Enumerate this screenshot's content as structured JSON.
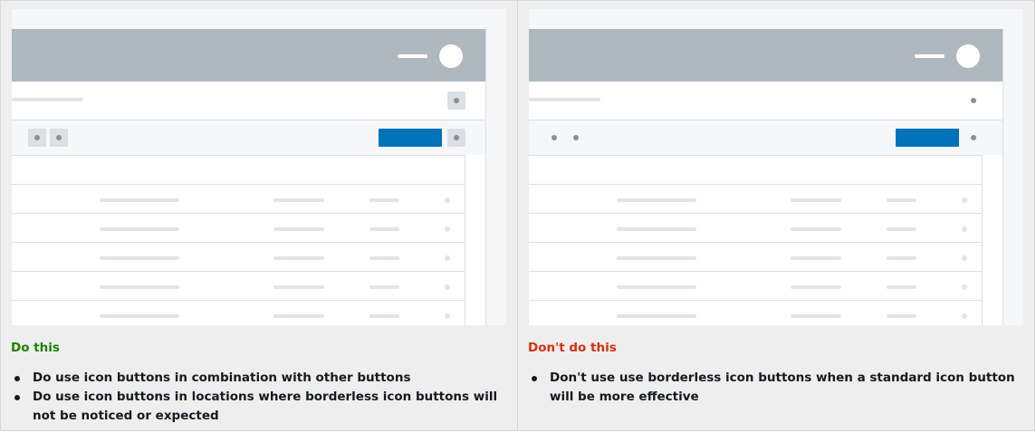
{
  "do_panel": {
    "title": "Do this",
    "bullets": [
      "Do use icon buttons in combination with other buttons",
      "Do use icon buttons in locations where borderless icon buttons will not be noticed or expected"
    ]
  },
  "dont_panel": {
    "title": "Don't do this",
    "bullets": [
      "Don't use use borderless icon buttons when a standard icon button will be more effective"
    ]
  },
  "colors": {
    "do_title": "#1d8102",
    "dont_title": "#d13212",
    "primary_button": "#0073bb",
    "mock_header": "#afb7bf"
  },
  "icons": [
    "avatar-icon",
    "dot-icon"
  ]
}
